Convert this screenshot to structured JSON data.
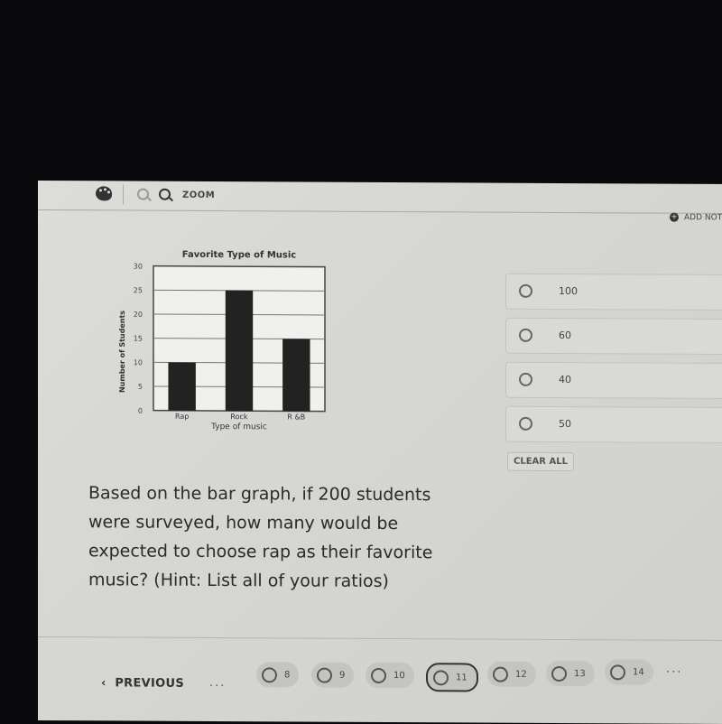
{
  "toolbar": {
    "palette_icon": "palette-icon",
    "zoom_out_icon": "zoom-out-icon",
    "zoom_in_icon": "zoom-in-icon",
    "zoom_label": "ZOOM",
    "add_note_icon": "plus-circle-icon",
    "add_note_label": "ADD NOTE"
  },
  "chart_data": {
    "type": "bar",
    "title": "Favorite Type of Music",
    "xlabel": "Type of music",
    "ylabel": "Number of Students",
    "categories": [
      "Rap",
      "Rock",
      "R &B"
    ],
    "values": [
      10,
      25,
      15
    ],
    "ylim": [
      0,
      30
    ],
    "yticks": [
      0,
      5,
      10,
      15,
      20,
      25,
      30
    ],
    "grid": true,
    "bar_color": "#222222"
  },
  "options": [
    {
      "label": "100"
    },
    {
      "label": "60"
    },
    {
      "label": "40"
    },
    {
      "label": "50"
    }
  ],
  "clear_all_label": "CLEAR ALL",
  "question": "Based on the bar graph, if 200 students were surveyed, how many would be expected to choose rap as their favorite music? (Hint:  List all of your ratios)",
  "footer": {
    "previous_label": "PREVIOUS",
    "previous_icon": "chevron-left-icon",
    "ellipsis": "...",
    "questions": [
      {
        "num": "8",
        "current": false
      },
      {
        "num": "9",
        "current": false
      },
      {
        "num": "10",
        "current": false
      },
      {
        "num": "11",
        "current": true
      },
      {
        "num": "12",
        "current": false
      },
      {
        "num": "13",
        "current": false
      },
      {
        "num": "14",
        "current": false
      }
    ]
  }
}
